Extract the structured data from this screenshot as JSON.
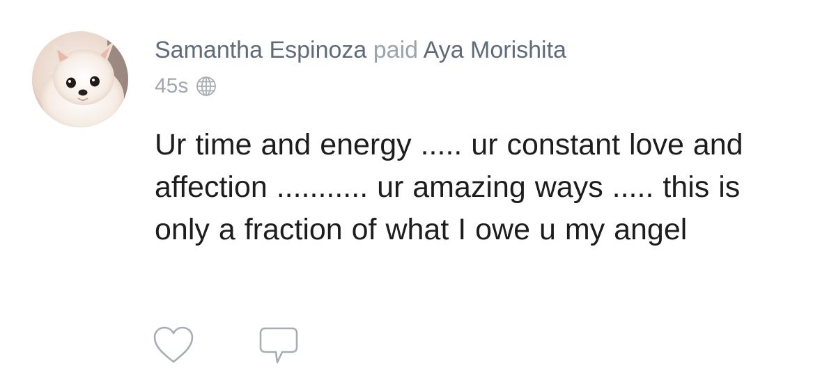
{
  "post": {
    "sender": "Samantha Espinoza",
    "verb": "paid",
    "recipient": "Aya Morishita",
    "time": "45s",
    "visibility_icon": "globe-icon",
    "message": "Ur time and energy ..... ur constant love and affection ........... ur amazing ways ..... this is only a fraction of what I owe u my angel"
  },
  "actions": {
    "like_icon": "heart-icon",
    "comment_icon": "speech-bubble-icon"
  },
  "colors": {
    "name": "#5f6b78",
    "muted": "#9ba3ab",
    "body_text": "#1d1d1f",
    "icon_stroke": "#a8adb3"
  }
}
